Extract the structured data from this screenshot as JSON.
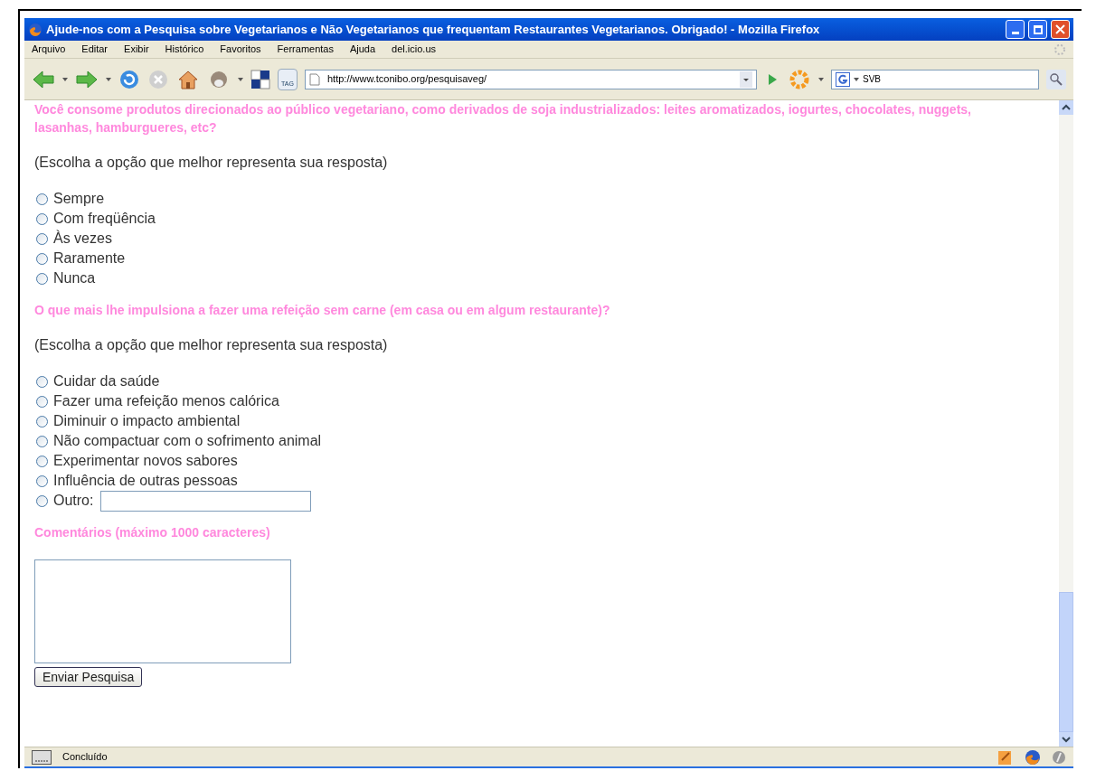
{
  "window": {
    "title": "Ajude-nos com a Pesquisa sobre Vegetarianos e Não Vegetarianos que frequentam Restaurantes Vegetarianos. Obrigado! - Mozilla Firefox"
  },
  "menu": [
    "Arquivo",
    "Editar",
    "Exibir",
    "Histórico",
    "Favoritos",
    "Ferramentas",
    "Ajuda",
    "del.icio.us"
  ],
  "toolbar": {
    "tag_label": "TAG",
    "url": "http://www.tconibo.org/pesquisaveg/",
    "search_value": "SVB"
  },
  "questions": [
    {
      "kind": "choice",
      "title": "Você consome produtos direcionados ao público vegetariano, como derivados de soja industrializados: leites aromatizados, iogurtes, chocolates, nuggets, lasanhas, hamburgueres, etc?",
      "hint": "(Escolha a opção que melhor representa sua resposta)",
      "options": [
        {
          "label": "Sempre",
          "selected": false
        },
        {
          "label": "Com freqüência",
          "selected": false
        },
        {
          "label": "Às vezes",
          "selected": false
        },
        {
          "label": "Raramente",
          "selected": false
        },
        {
          "label": "Nunca",
          "selected": false
        }
      ]
    },
    {
      "kind": "choice",
      "title": "O que mais lhe impulsiona a fazer uma refeição sem carne (em casa ou em algum restaurante)?",
      "hint": "(Escolha a opção que melhor representa sua resposta)",
      "options": [
        {
          "label": "Cuidar da saúde",
          "selected": false
        },
        {
          "label": "Fazer uma refeição menos calórica",
          "selected": false
        },
        {
          "label": "Diminuir o impacto ambiental",
          "selected": false
        },
        {
          "label": "Não compactuar com o sofrimento animal",
          "selected": false
        },
        {
          "label": "Experimentar novos sabores",
          "selected": false
        },
        {
          "label": "Influência de outras pessoas",
          "selected": false
        },
        {
          "label": "Outro:",
          "selected": false,
          "kind": "other"
        }
      ]
    },
    {
      "kind": "comment",
      "title": "Comentários (máximo 1000 caracteres)"
    }
  ],
  "submit": "Enviar Pesquisa",
  "status_bar": {
    "text": "Concluído"
  }
}
